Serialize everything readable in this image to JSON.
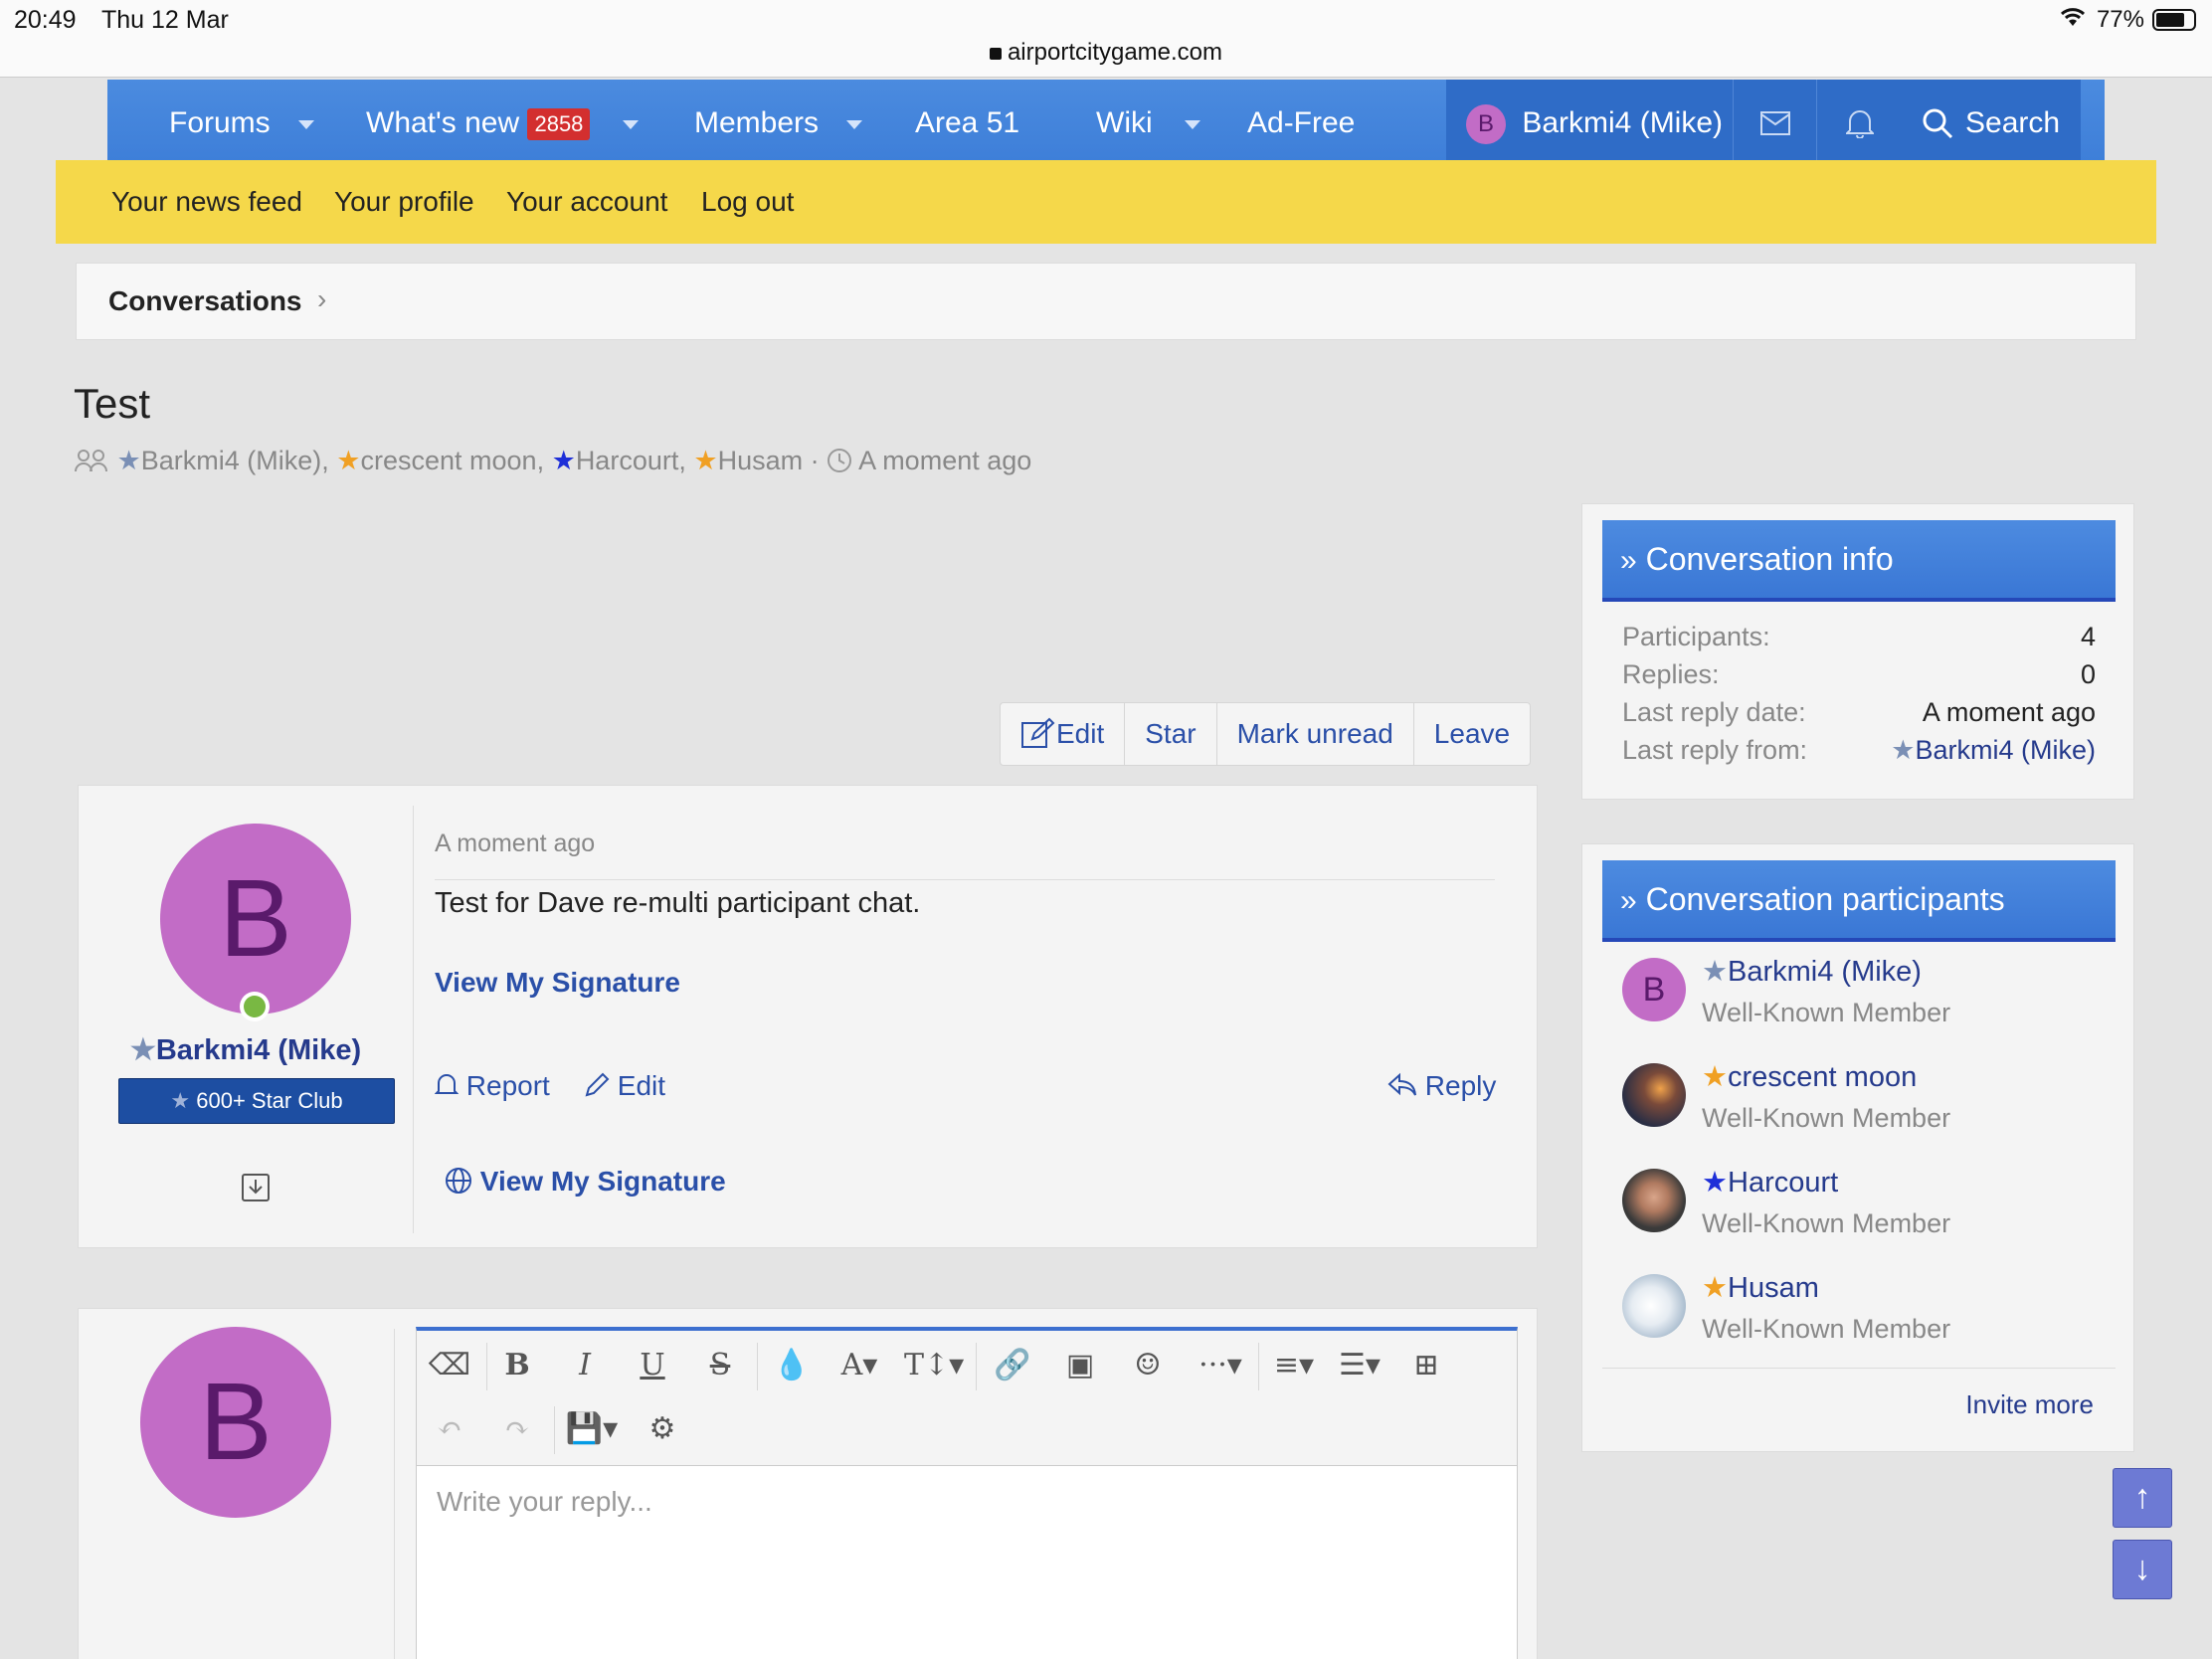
{
  "status_bar": {
    "time": "20:49",
    "date": "Thu 12 Mar",
    "url": "airportcitygame.com",
    "battery": "77%"
  },
  "nav": {
    "forums": "Forums",
    "whats_new": "What's new",
    "whats_new_badge": "2858",
    "members": "Members",
    "area51": "Area 51",
    "wiki": "Wiki",
    "adfree": "Ad-Free",
    "user_initial": "B",
    "user": "Barkmi4 (Mike)",
    "search": "Search"
  },
  "subnav": {
    "news_feed": "Your news feed",
    "profile": "Your profile",
    "account": "Your account",
    "logout": "Log out"
  },
  "breadcrumb": {
    "label": "Conversations"
  },
  "conversation": {
    "title": "Test",
    "participants": [
      "Barkmi4 (Mike),",
      "crescent moon,",
      "Harcourt,",
      "Husam"
    ],
    "separator": "·",
    "time": "A moment ago"
  },
  "actions": {
    "edit": "Edit",
    "star": "Star",
    "mark_unread": "Mark unread",
    "leave": "Leave"
  },
  "message": {
    "avatar_initial": "B",
    "author": "Barkmi4 (Mike)",
    "banner": "600+ Star Club",
    "time": "A moment ago",
    "body": "Test for Dave re-multi participant chat.",
    "signature_link": "View My Signature",
    "report": "Report",
    "edit": "Edit",
    "reply": "Reply",
    "signature_link2": "View My Signature"
  },
  "reply_editor": {
    "avatar_initial": "B",
    "placeholder": "Write your reply..."
  },
  "info": {
    "heading": "Conversation info",
    "rows": [
      {
        "label": "Participants:",
        "value": "4"
      },
      {
        "label": "Replies:",
        "value": "0"
      },
      {
        "label": "Last reply date:",
        "value": "A moment ago"
      },
      {
        "label": "Last reply from:",
        "value": "Barkmi4 (Mike)"
      }
    ]
  },
  "participants_block": {
    "heading": "Conversation participants",
    "members": [
      {
        "name": "Barkmi4 (Mike)",
        "title": "Well-Known Member",
        "initial": "B"
      },
      {
        "name": "crescent moon",
        "title": "Well-Known Member"
      },
      {
        "name": "Harcourt",
        "title": "Well-Known Member"
      },
      {
        "name": "Husam",
        "title": "Well-Known Member"
      }
    ],
    "invite": "Invite more"
  },
  "colors": {
    "nav_blue": "#3d7ed8",
    "subnav_yellow": "#f5d84a",
    "link": "#253a8c",
    "avatar_purple": "#c26cc6"
  }
}
